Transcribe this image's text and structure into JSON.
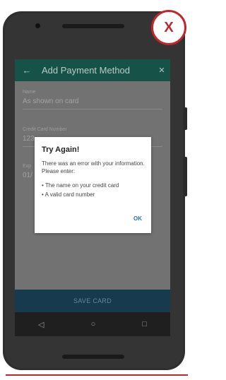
{
  "badge": {
    "label": "X",
    "color": "#c0272d"
  },
  "appbar": {
    "back_icon": "arrow-back-icon",
    "title": "Add Payment Method",
    "close_icon": "close-icon",
    "color": "#175248"
  },
  "form": {
    "name": {
      "label": "Name",
      "value": "As shown on card"
    },
    "card": {
      "label": "Credit Card Number",
      "value": "123"
    },
    "expiry": {
      "label": "Exp",
      "value": "01/"
    }
  },
  "save_button": {
    "label": "SAVE CARD"
  },
  "navbar": {
    "back": "◁",
    "home": "○",
    "recents": "□"
  },
  "dialog": {
    "title": "Try Again!",
    "message": "There was an error with your information. Please enter:",
    "bullets": [
      "• The name on your credit card",
      "• A valid card number"
    ],
    "ok_label": "OK"
  }
}
